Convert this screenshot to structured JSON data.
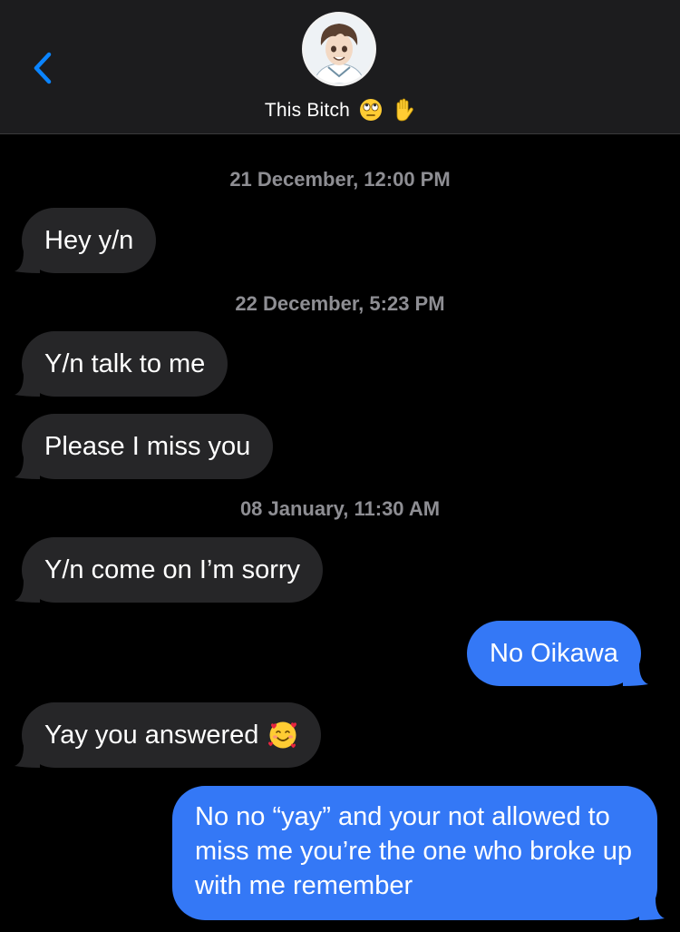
{
  "header": {
    "back_icon": "chevron-left-icon",
    "avatar_icon": "contact-avatar",
    "contact_name": "This Bitch",
    "name_emojis": [
      "face-with-rolling-eyes-emoji",
      "raised-hand-emoji"
    ]
  },
  "conversation": {
    "timestamps": [
      "21 December, 12:00 PM",
      "22 December, 5:23 PM",
      "08 January, 11:30 AM"
    ],
    "messages": [
      {
        "from": "them",
        "text": "Hey y/n"
      },
      {
        "from": "them",
        "text": "Y/n talk to me"
      },
      {
        "from": "them",
        "text": "Please I miss you"
      },
      {
        "from": "them",
        "text": "Y/n come on I’m sorry"
      },
      {
        "from": "me",
        "text": "No Oikawa"
      },
      {
        "from": "them",
        "text": "Yay you answered",
        "emoji": "smiling-face-with-hearts-emoji"
      },
      {
        "from": "me",
        "text": "No no “yay” and your not allowed to miss me you’re the one who broke up with me remember"
      }
    ]
  },
  "colors": {
    "background": "#000000",
    "header_bg": "#1c1c1e",
    "incoming_bubble": "#262628",
    "outgoing_bubble": "#3478f6",
    "accent_blue": "#0a84ff",
    "timestamp_gray": "#8e8e93"
  }
}
